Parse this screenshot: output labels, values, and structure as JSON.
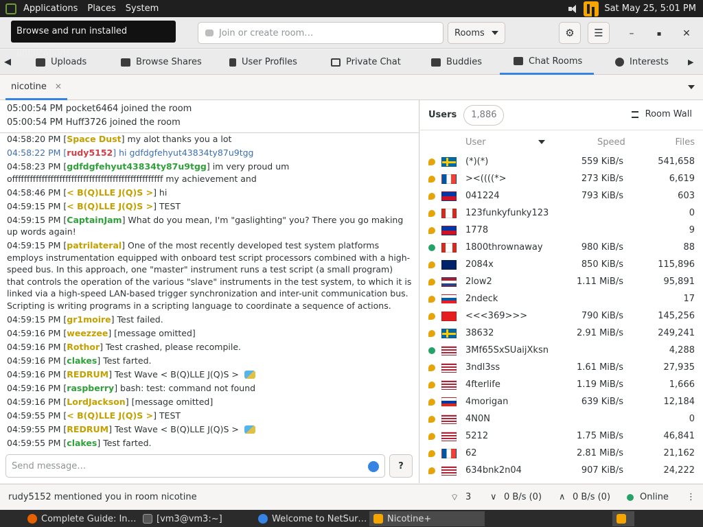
{
  "top_panel": {
    "applications": "Applications",
    "places": "Places",
    "system": "System",
    "clock": "Sat May 25,  5:01 PM"
  },
  "tooltip": "Browse and run installed applications",
  "header": {
    "search_placeholder": "Join or create room…",
    "rooms_label": "Rooms"
  },
  "tabs": [
    {
      "label": "Uploads"
    },
    {
      "label": "Browse Shares"
    },
    {
      "label": "User Profiles"
    },
    {
      "label": "Private Chat"
    },
    {
      "label": "Buddies"
    },
    {
      "label": "Chat Rooms"
    },
    {
      "label": "Interests"
    }
  ],
  "room_tab": "nicotine",
  "activity": [
    "05:00:54 PM pocket6464 joined the room",
    "05:00:54 PM Huff3726 joined the room"
  ],
  "messages": [
    {
      "ts": "04:58:20 PM",
      "user": "Space Dust",
      "text": "my alot thanks you a lot",
      "color": "yellow"
    },
    {
      "ts": "04:58:22 PM",
      "user": "rudy5152",
      "text": "hi gdfdgfehyut43834ty87u9tgg",
      "color": "red",
      "highlight": true
    },
    {
      "ts": "04:58:23 PM",
      "user": "gdfdgfehyut43834ty87u9tgg",
      "text": "im very proud um offfffffffffffffffffffffffffffffffffffffffffffffffff my achievement and",
      "color": "green"
    },
    {
      "ts": "04:58:46 PM",
      "user": "< B(Q)LLE J(Q)S >",
      "text": "hi",
      "color": "yellow"
    },
    {
      "ts": "04:59:15 PM",
      "user": "< B(Q)LLE J(Q)S >",
      "text": "TEST",
      "color": "yellow"
    },
    {
      "ts": "04:59:15 PM",
      "user": "CaptainJam",
      "text": "What do you mean, I'm \"gaslighting\" you? There you go making up words again!",
      "color": "green"
    },
    {
      "ts": "04:59:15 PM",
      "user": "patrilateral",
      "text": "One of the most recently developed test system platforms employs instrumentation equipped with onboard test script processors combined with a high-speed bus. In this approach, one \"master\" instrument runs a test script (a small program) that controls the operation of the various \"slave\" instruments in the test system, to which it is linked via a high-speed LAN-based trigger synchronization and inter-unit communication bus. Scripting is writing programs in a scripting language to coordinate a sequence of actions.",
      "color": "yellow"
    },
    {
      "ts": "04:59:15 PM",
      "user": "gr1moire",
      "text": "Test failed.",
      "color": "yellow"
    },
    {
      "ts": "04:59:16 PM",
      "user": "weezzee",
      "text": "[message omitted]",
      "color": "yellow"
    },
    {
      "ts": "04:59:16 PM",
      "user": "Rothor",
      "text": "Test crashed, please recompile.",
      "color": "yellow"
    },
    {
      "ts": "04:59:16 PM",
      "user": "clakes",
      "text": "Test farted.",
      "color": "green"
    },
    {
      "ts": "04:59:16 PM",
      "user": "REDRUM",
      "text": "Test Wave < B(Q)LLE J(Q)S >",
      "color": "yellow",
      "surfer": true
    },
    {
      "ts": "04:59:16 PM",
      "user": "raspberry",
      "text": "bash: test: command not found",
      "color": "green"
    },
    {
      "ts": "04:59:16 PM",
      "user": "LordJackson",
      "text": "[message omitted]",
      "color": "yellow"
    },
    {
      "ts": "04:59:55 PM",
      "user": "< B(Q)LLE J(Q)S >",
      "text": "TEST",
      "color": "yellow"
    },
    {
      "ts": "04:59:55 PM",
      "user": "REDRUM",
      "text": "Test Wave < B(Q)LLE J(Q)S >",
      "color": "yellow",
      "surfer": true
    },
    {
      "ts": "04:59:55 PM",
      "user": "clakes",
      "text": "Test farted.",
      "color": "green"
    }
  ],
  "send_placeholder": "Send message…",
  "users_panel": {
    "title": "Users",
    "count": "1,886",
    "room_wall": "Room Wall",
    "columns": {
      "user": "User",
      "speed": "Speed",
      "files": "Files"
    },
    "rows": [
      {
        "status": "away",
        "flag": "se",
        "name": "(*)(*)",
        "speed": "559 KiB/s",
        "files": "541,658"
      },
      {
        "status": "away",
        "flag": "fr",
        "name": "><((((*>",
        "speed": "273 KiB/s",
        "files": "6,619"
      },
      {
        "status": "away",
        "flag": "ph",
        "name": "041224",
        "speed": "793 KiB/s",
        "files": "603"
      },
      {
        "status": "away",
        "flag": "ca",
        "name": "123funkyfunky123",
        "speed": "",
        "files": "0"
      },
      {
        "status": "away",
        "flag": "ph",
        "name": "1778",
        "speed": "",
        "files": "9"
      },
      {
        "status": "online",
        "flag": "ca",
        "name": "1800thrownaway",
        "speed": "980 KiB/s",
        "files": "88"
      },
      {
        "status": "away",
        "flag": "au",
        "name": "2084x",
        "speed": "850 KiB/s",
        "files": "115,896"
      },
      {
        "status": "away",
        "flag": "nl",
        "name": "2low2",
        "speed": "1.11 MiB/s",
        "files": "95,891"
      },
      {
        "status": "away",
        "flag": "si",
        "name": "2ndeck",
        "speed": "",
        "files": "17"
      },
      {
        "status": "away",
        "flag": "al",
        "name": "<<<369>>>",
        "speed": "790 KiB/s",
        "files": "145,256"
      },
      {
        "status": "away",
        "flag": "se",
        "name": "38632",
        "speed": "2.91 MiB/s",
        "files": "249,241"
      },
      {
        "status": "online",
        "flag": "us",
        "name": "3Mf65SxSUaijXksn",
        "speed": "",
        "files": "4,288"
      },
      {
        "status": "away",
        "flag": "us",
        "name": "3ndl3ss",
        "speed": "1.61 MiB/s",
        "files": "27,935"
      },
      {
        "status": "away",
        "flag": "us",
        "name": "4fterlife",
        "speed": "1.19 MiB/s",
        "files": "1,666"
      },
      {
        "status": "away",
        "flag": "ru",
        "name": "4morigan",
        "speed": "639 KiB/s",
        "files": "12,184"
      },
      {
        "status": "away",
        "flag": "us",
        "name": "4N0N",
        "speed": "",
        "files": "0"
      },
      {
        "status": "away",
        "flag": "us",
        "name": "5212",
        "speed": "1.75 MiB/s",
        "files": "46,841"
      },
      {
        "status": "away",
        "flag": "fr",
        "name": "62",
        "speed": "2.81 MiB/s",
        "files": "21,162"
      },
      {
        "status": "away",
        "flag": "us",
        "name": "634bnk2n04",
        "speed": "907 KiB/s",
        "files": "24,222"
      }
    ]
  },
  "statusbar": {
    "message": "rudy5152 mentioned you in room nicotine",
    "connections": "3",
    "down": "0 B/s (0)",
    "up": "0 B/s (0)",
    "status": "Online"
  },
  "taskbar": [
    {
      "label": "Complete Guide: In…",
      "active": false
    },
    {
      "label": "[vm3@vm3:~]",
      "active": false
    },
    {
      "label": "Welcome to NetSur…",
      "active": false
    },
    {
      "label": "Nicotine+",
      "active": true
    }
  ],
  "colors": {
    "accent": "#3584e4",
    "user_yellow": "#c4a000",
    "user_green": "#30a13a",
    "user_red": "#cf3f47",
    "online": "#26a269",
    "away": "#e5a50a"
  }
}
